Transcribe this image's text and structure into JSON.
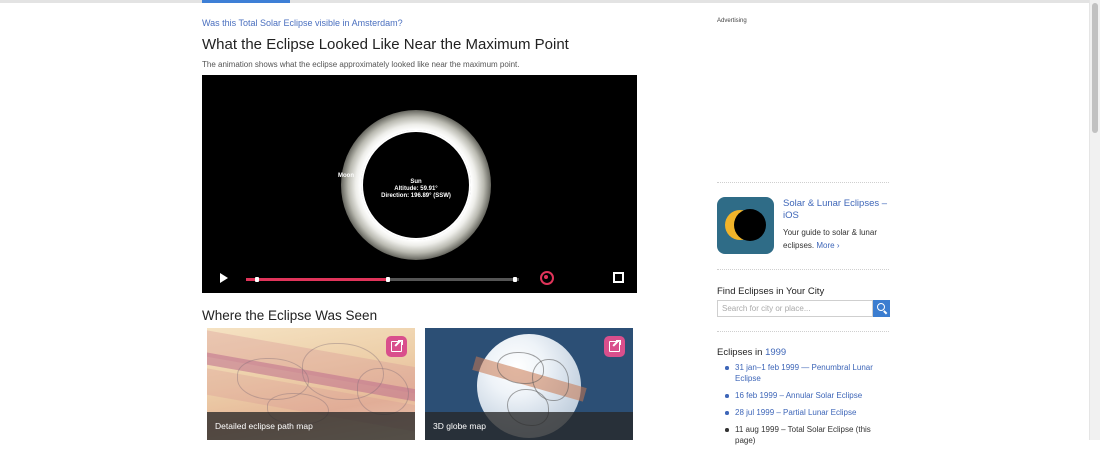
{
  "main": {
    "back_link": "Was this Total Solar Eclipse visible in Amsterdam?",
    "section_title": "What the Eclipse Looked Like Near the Maximum Point",
    "section_desc": "The animation shows what the eclipse approximately looked like near the maximum point.",
    "video": {
      "moon_label": "Moon",
      "sun_label": "Sun",
      "altitude_label": "Altitude: 59.91°",
      "direction_label": "Direction: 196.89° (SSW)",
      "progress_fraction": 0.52
    },
    "maps_title": "Where the Eclipse Was Seen",
    "maps": [
      {
        "caption": "Detailed eclipse path map"
      },
      {
        "caption": "3D globe map"
      }
    ]
  },
  "sidebar": {
    "ad_label": "Advertising",
    "app": {
      "title": "Solar & Lunar Eclipses – iOS",
      "description": "Your guide to solar & lunar eclipses.",
      "more_label": "More"
    },
    "find": {
      "title": "Find Eclipses in Your City",
      "placeholder": "Search for city or place..."
    },
    "eclipses": {
      "title_prefix": "Eclipses in ",
      "year": "1999",
      "items": [
        "31 jan–1 feb 1999 — Penumbral Lunar Eclipse",
        "16 feb 1999 – Annular Solar Eclipse",
        "28 jul 1999 – Partial Lunar Eclipse",
        "11 aug 1999 – Total Solar Eclipse (this page)"
      ]
    }
  },
  "colors": {
    "accent": "#3e7fd6",
    "link": "#3e66b8",
    "progress": "#e0345a",
    "external_button": "#d94f8c"
  }
}
